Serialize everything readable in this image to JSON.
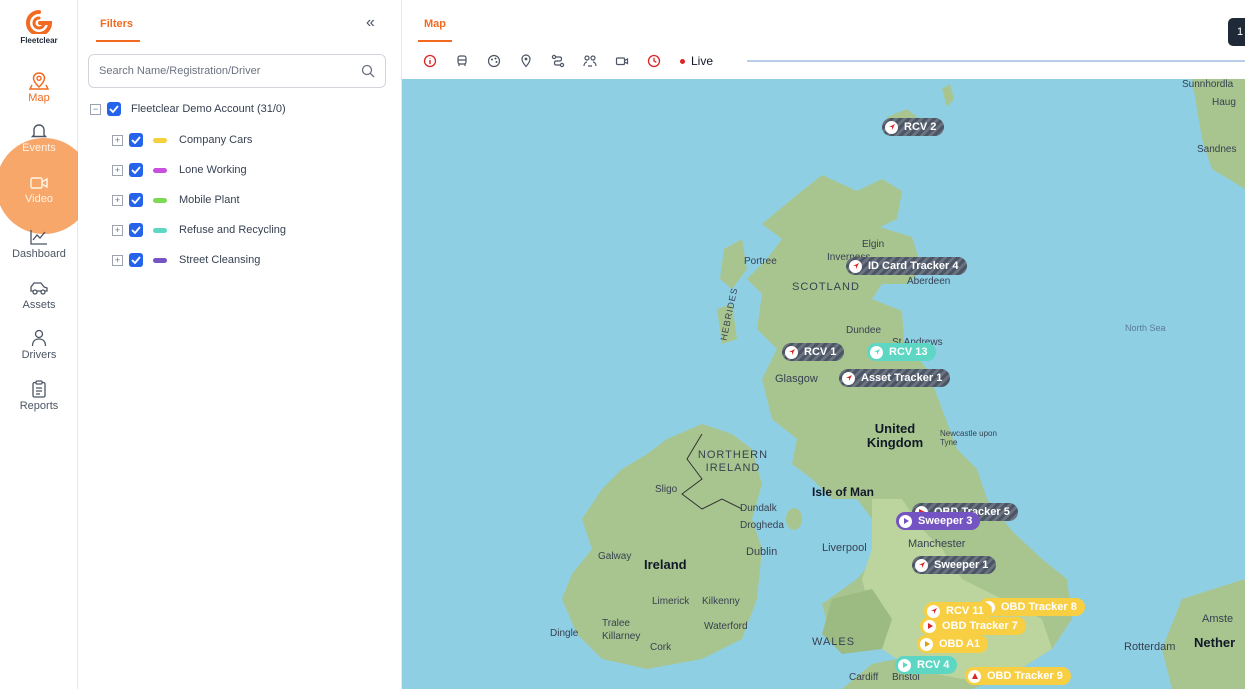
{
  "brand": {
    "name": "Fleetclear",
    "accent": "#f26a21"
  },
  "nav": [
    {
      "key": "map",
      "label": "Map",
      "icon": "map-pin-icon",
      "active": true
    },
    {
      "key": "events",
      "label": "Events",
      "icon": "bell-icon",
      "active": false
    },
    {
      "key": "video",
      "label": "Video",
      "icon": "video-camera-icon",
      "active": false
    },
    {
      "key": "dashboard",
      "label": "Dashboard",
      "icon": "line-chart-icon",
      "active": false
    },
    {
      "key": "assets",
      "label": "Assets",
      "icon": "vehicle-icon",
      "active": false
    },
    {
      "key": "drivers",
      "label": "Drivers",
      "icon": "person-icon",
      "active": false
    },
    {
      "key": "reports",
      "label": "Reports",
      "icon": "clipboard-icon",
      "active": false
    }
  ],
  "filters": {
    "tab_label": "Filters",
    "collapse_glyph": "«",
    "search_placeholder": "Search Name/Registration/Driver",
    "root": {
      "label": "Fleetclear Demo Account (31/0)",
      "checked": true,
      "expander": "−"
    },
    "groups": [
      {
        "label": "Company Cars",
        "color": "#f6cf3f",
        "checked": true,
        "expander": "+"
      },
      {
        "label": "Lone Working",
        "color": "#c84fe0",
        "checked": true,
        "expander": "+"
      },
      {
        "label": "Mobile Plant",
        "color": "#7ed957",
        "checked": true,
        "expander": "+"
      },
      {
        "label": "Refuse and Recycling",
        "color": "#5ed6c4",
        "checked": true,
        "expander": "+"
      },
      {
        "label": "Street Cleansing",
        "color": "#7453c2",
        "checked": true,
        "expander": "+"
      }
    ]
  },
  "map": {
    "tab_label": "Map",
    "live_label": "Live",
    "corner_button": "1",
    "toolbar_icons": [
      "info-icon",
      "vehicle-filter-icon",
      "palette-icon",
      "location-icon",
      "route-icon",
      "group-icon",
      "camera-icon",
      "clock-icon"
    ],
    "places": [
      {
        "name": "Sunnhordla",
        "kind": "place"
      },
      {
        "name": "Haug",
        "kind": "place"
      },
      {
        "name": "Sandnes",
        "kind": "place"
      },
      {
        "name": "Elgin",
        "kind": "place"
      },
      {
        "name": "Portree",
        "kind": "place"
      },
      {
        "name": "Inverness",
        "kind": "place"
      },
      {
        "name": "Aberdeen",
        "kind": "place"
      },
      {
        "name": "SCOTLAND",
        "kind": "region"
      },
      {
        "name": "HEBRIDES",
        "kind": "region"
      },
      {
        "name": "Dundee",
        "kind": "place"
      },
      {
        "name": "St Andrews",
        "kind": "place"
      },
      {
        "name": "Glasgow",
        "kind": "place"
      },
      {
        "name": "North Sea",
        "kind": "sea"
      },
      {
        "name": "United Kingdom",
        "kind": "big"
      },
      {
        "name": "Newcastle upon Tyne",
        "kind": "place"
      },
      {
        "name": "NORTHERN IRELAND",
        "kind": "region"
      },
      {
        "name": "Sligo",
        "kind": "place"
      },
      {
        "name": "Dundalk",
        "kind": "place"
      },
      {
        "name": "Isle of Man",
        "kind": "big"
      },
      {
        "name": "Drogheda",
        "kind": "place"
      },
      {
        "name": "Galway",
        "kind": "place"
      },
      {
        "name": "Dublin",
        "kind": "place"
      },
      {
        "name": "Ireland",
        "kind": "big"
      },
      {
        "name": "Liverpool",
        "kind": "place"
      },
      {
        "name": "Manchester",
        "kind": "place"
      },
      {
        "name": "Limerick",
        "kind": "place"
      },
      {
        "name": "Kilkenny",
        "kind": "place"
      },
      {
        "name": "Dingle",
        "kind": "place"
      },
      {
        "name": "Tralee",
        "kind": "place"
      },
      {
        "name": "Killarney",
        "kind": "place"
      },
      {
        "name": "Cork",
        "kind": "place"
      },
      {
        "name": "Waterford",
        "kind": "place"
      },
      {
        "name": "WALES",
        "kind": "region"
      },
      {
        "name": "Cardiff",
        "kind": "place"
      },
      {
        "name": "Bristol",
        "kind": "place"
      },
      {
        "name": "Amste",
        "kind": "place"
      },
      {
        "name": "Rotterdam",
        "kind": "place"
      },
      {
        "name": "Nether",
        "kind": "big"
      }
    ],
    "markers": [
      {
        "label": "RCV 2",
        "style": "stripe"
      },
      {
        "label": "ID Card Tracker 4",
        "style": "stripe"
      },
      {
        "label": "RCV 1",
        "style": "stripe"
      },
      {
        "label": "RCV 13",
        "style": "teal"
      },
      {
        "label": "Asset Tracker 1",
        "style": "stripe"
      },
      {
        "label": "OBD Tracker 5",
        "style": "stripe"
      },
      {
        "label": "Sweeper 3",
        "style": "purple"
      },
      {
        "label": "Sweeper 1",
        "style": "stripe"
      },
      {
        "label": "RCV 11",
        "style": "yellow"
      },
      {
        "label": "OBD Tracker 8",
        "style": "yellow"
      },
      {
        "label": "OBD Tracker 7",
        "style": "yellow"
      },
      {
        "label": "OBD A1",
        "style": "yellow"
      },
      {
        "label": "RCV 4",
        "style": "teal"
      },
      {
        "label": "OBD Tracker 9",
        "style": "yellow"
      }
    ]
  }
}
